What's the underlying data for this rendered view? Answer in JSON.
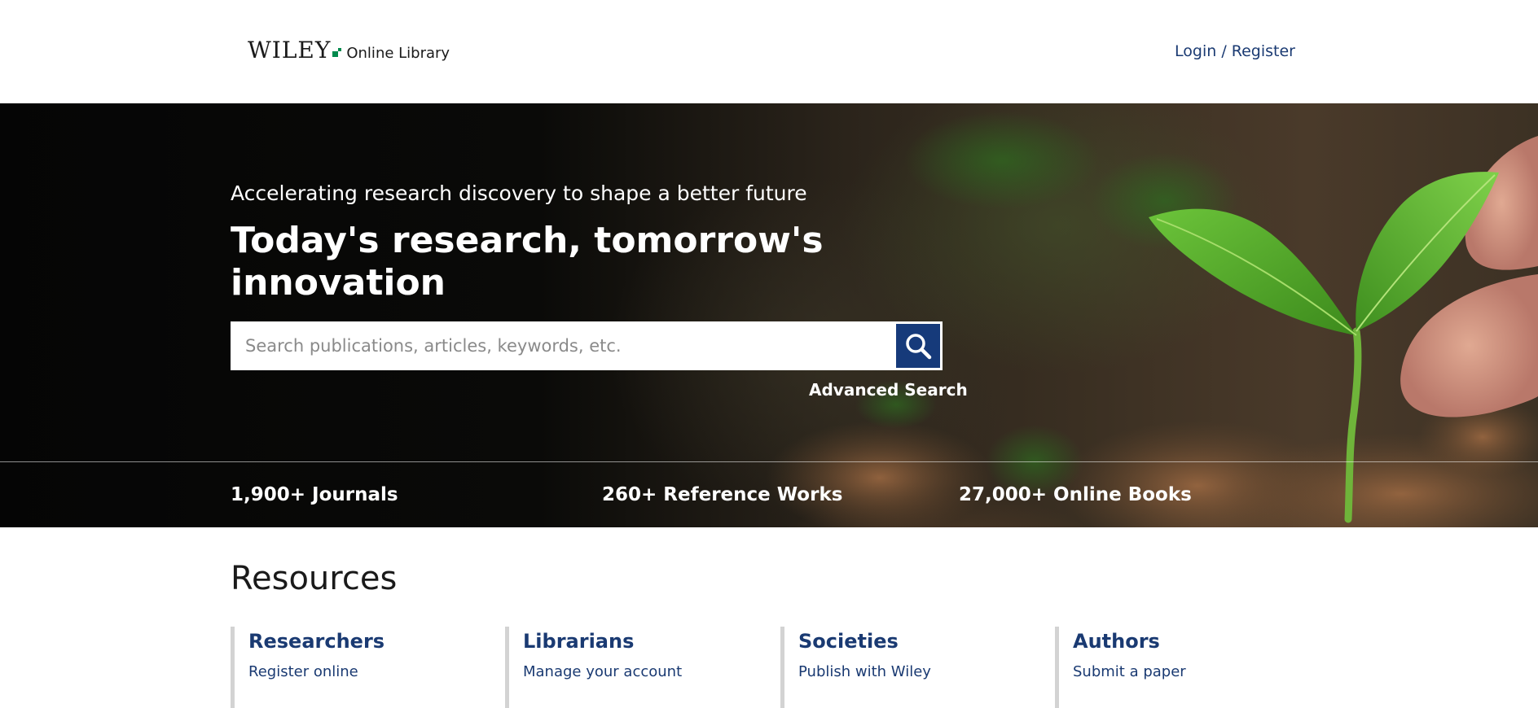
{
  "header": {
    "logo_wordmark": "WILEY",
    "logo_subtitle": "Online Library",
    "login_label": "Login / Register"
  },
  "hero": {
    "tagline": "Accelerating research discovery to shape a better future",
    "title": "Today's research, tomorrow's innovation",
    "search": {
      "placeholder": "Search publications, articles, keywords, etc.",
      "value": ""
    },
    "advanced_search_label": "Advanced Search",
    "stats": [
      {
        "label": "1,900+ Journals"
      },
      {
        "label": "260+ Reference Works"
      },
      {
        "label": "27,000+ Online Books"
      }
    ]
  },
  "resources": {
    "title": "Resources",
    "columns": [
      {
        "heading": "Researchers",
        "links": [
          "Register online"
        ]
      },
      {
        "heading": "Librarians",
        "links": [
          "Manage your account"
        ]
      },
      {
        "heading": "Societies",
        "links": [
          "Publish with Wiley"
        ]
      },
      {
        "heading": "Authors",
        "links": [
          "Submit a paper"
        ]
      }
    ]
  },
  "colors": {
    "brand_navy": "#1a3a72",
    "search_button": "#163a7a",
    "logo_green": "#008a4d",
    "column_border": "#d3d3d3"
  },
  "icons": {
    "search": "search-icon"
  }
}
